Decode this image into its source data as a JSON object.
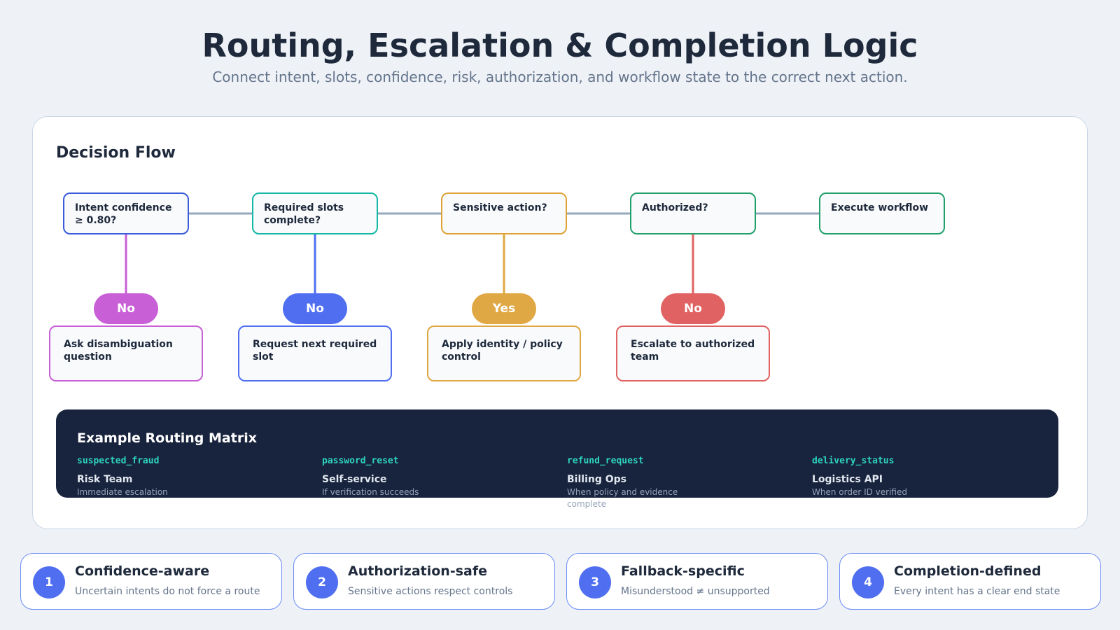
{
  "header": {
    "title": "Routing, Escalation & Completion Logic",
    "subtitle": "Connect intent, slots, confidence, risk, authorization, and workflow state to the correct next action."
  },
  "flow": {
    "title": "Decision Flow",
    "nodes": [
      {
        "label": "Intent confidence ≥ 0.80?",
        "color": "#3b5bdb"
      },
      {
        "label": "Required slots complete?",
        "color": "#14b8a6"
      },
      {
        "label": "Sensitive action?",
        "color": "#e0a236"
      },
      {
        "label": "Authorized?",
        "color": "#22a06b"
      },
      {
        "label": "Execute workflow",
        "color": "#22a06b"
      }
    ],
    "branches": [
      {
        "answer": "No",
        "color": "#c85fd6",
        "outcome": "Ask disambiguation question"
      },
      {
        "answer": "No",
        "color": "#4f6ff0",
        "outcome": "Request next required slot"
      },
      {
        "answer": "Yes",
        "color": "#e0a844",
        "outcome": "Apply identity / policy control"
      },
      {
        "answer": "No",
        "color": "#e06262",
        "outcome": "Escalate to authorized team"
      }
    ],
    "connector_color": "#94a9bd"
  },
  "matrix": {
    "title": "Example Routing Matrix",
    "rows": [
      {
        "intent": "suspected_fraud",
        "team": "Risk Team",
        "note": "Immediate escalation"
      },
      {
        "intent": "password_reset",
        "team": "Self-service",
        "note": "If verification succeeds"
      },
      {
        "intent": "refund_request",
        "team": "Billing Ops",
        "note": "When policy and evidence complete"
      },
      {
        "intent": "delivery_status",
        "team": "Logistics API",
        "note": "When order ID verified"
      }
    ]
  },
  "principles": [
    {
      "number": "1",
      "title": "Confidence-aware",
      "description": "Uncertain intents do not force a route"
    },
    {
      "number": "2",
      "title": "Authorization-safe",
      "description": "Sensitive actions respect controls"
    },
    {
      "number": "3",
      "title": "Fallback-specific",
      "description": "Misunderstood ≠ unsupported"
    },
    {
      "number": "4",
      "title": "Completion-defined",
      "description": "Every intent has a clear end state"
    }
  ]
}
